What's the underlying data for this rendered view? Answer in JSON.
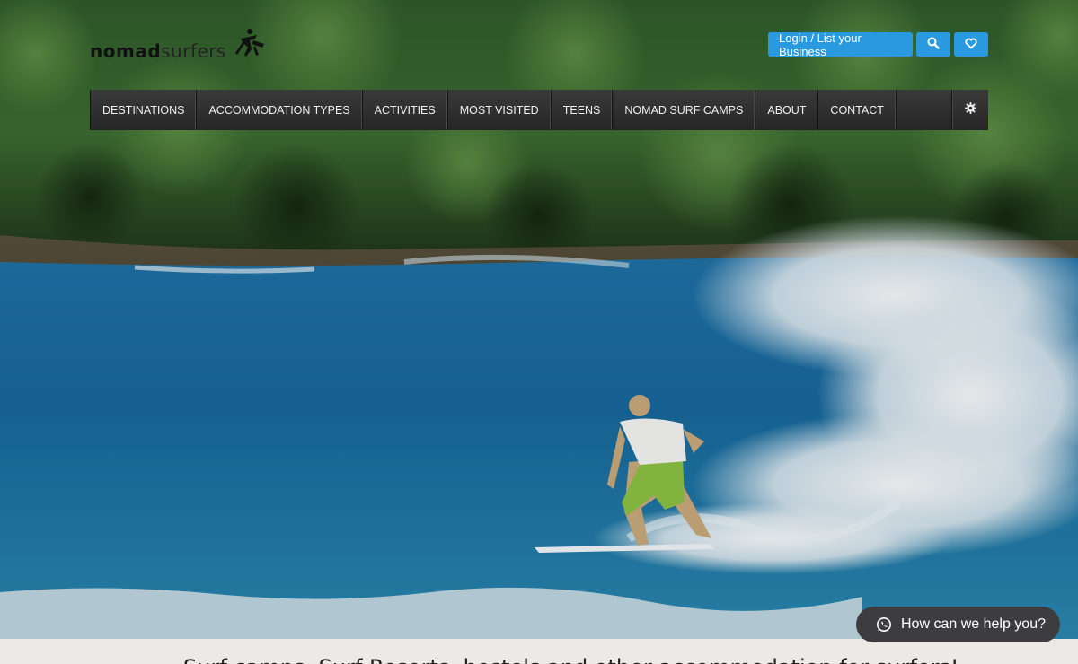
{
  "logo": {
    "bold": "nomad",
    "light": "surfers"
  },
  "header": {
    "login_label": "Login / List your Business",
    "search_icon": "search-icon",
    "favorites_icon": "heart-icon"
  },
  "nav": {
    "items": [
      {
        "label": "DESTINATIONS"
      },
      {
        "label": "ACCOMMODATION TYPES"
      },
      {
        "label": "ACTIVITIES"
      },
      {
        "label": "MOST VISITED"
      },
      {
        "label": "TEENS"
      },
      {
        "label": "NOMAD SURF CAMPS"
      },
      {
        "label": "ABOUT"
      },
      {
        "label": "CONTACT"
      }
    ],
    "settings_icon": "gear-icon"
  },
  "chat": {
    "label": "How can we help you?",
    "icon": "whatsapp-icon"
  },
  "tagline": {
    "text": "Surf camps, Surf Resorts, hostels and other accommodation for surfers!"
  },
  "colors": {
    "accent": "#2a9ae0",
    "navbar": "#2e2e2e",
    "chat_bg": "#3d3d3f",
    "band": "#ece9e6"
  }
}
